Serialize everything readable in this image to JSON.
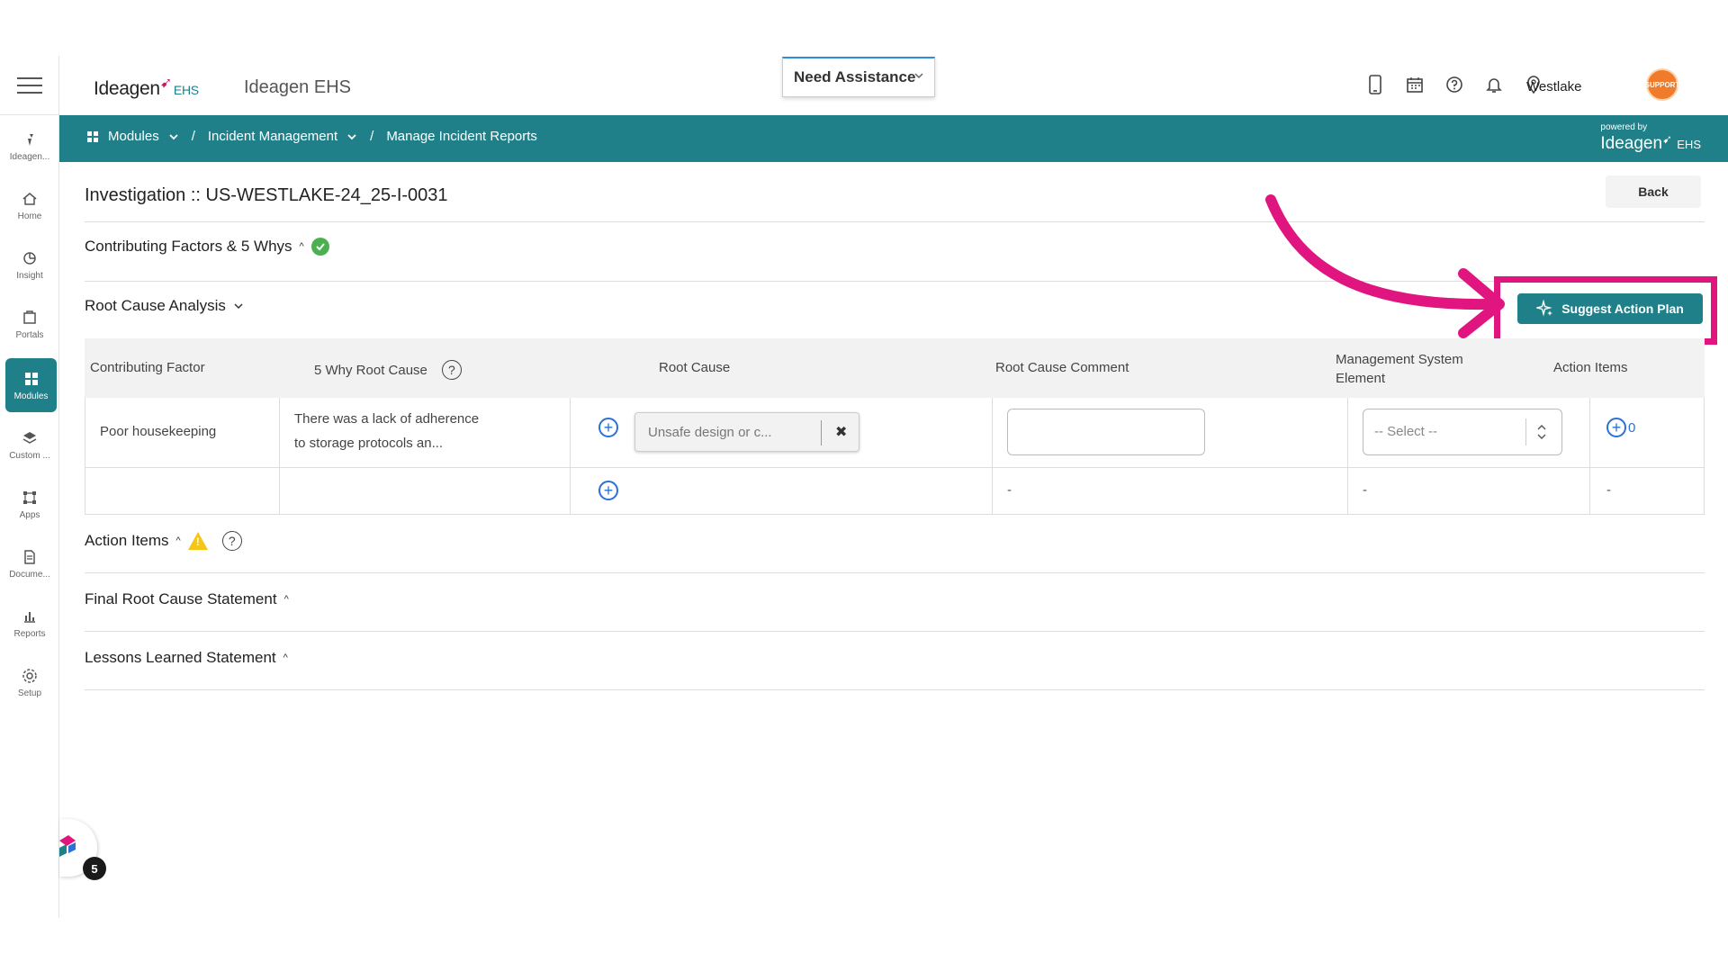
{
  "rail": {
    "items": [
      {
        "label": "Ideagen...",
        "icon": "ideagen-icon"
      },
      {
        "label": "Home",
        "icon": "home-icon"
      },
      {
        "label": "Insight",
        "icon": "insight-icon"
      },
      {
        "label": "Portals",
        "icon": "portals-icon"
      },
      {
        "label": "Modules",
        "icon": "modules-icon"
      },
      {
        "label": "Custom ...",
        "icon": "custom-icon"
      },
      {
        "label": "Apps",
        "icon": "apps-icon"
      },
      {
        "label": "Docume...",
        "icon": "documents-icon"
      },
      {
        "label": "Reports",
        "icon": "reports-icon"
      },
      {
        "label": "Setup",
        "icon": "setup-icon"
      }
    ]
  },
  "header": {
    "logo_text": "Ideagen",
    "logo_suffix": "EHS",
    "app_name": "Ideagen EHS",
    "assistance": "Need Assistance",
    "location": "Westlake",
    "avatar_text": "SUPPORT"
  },
  "breadcrumb": {
    "modules": "Modules",
    "incident_management": "Incident Management",
    "manage_reports": "Manage Incident Reports",
    "sep": "/",
    "powered_by": "powered by",
    "powered_logo": "Ideagen",
    "powered_suffix": "EHS"
  },
  "page": {
    "title": "Investigation :: US-WESTLAKE-24_25-I-0031",
    "back_label": "Back"
  },
  "sections": {
    "contributing": "Contributing Factors & 5 Whys",
    "rca": "Root Cause Analysis",
    "action_items": "Action Items",
    "final_statement": "Final Root Cause Statement",
    "lessons": "Lessons Learned Statement"
  },
  "suggest_label": "Suggest Action Plan",
  "table": {
    "headers": {
      "contributing_factor": "Contributing Factor",
      "five_why": "5 Why Root Cause",
      "root_cause": "Root Cause",
      "comment": "Root Cause Comment",
      "mse_line1": "Management System",
      "mse_line2": "Element",
      "action_items": "Action Items"
    },
    "row1": {
      "factor": "Poor housekeeping",
      "five_why_line1": "There was a lack of adherence",
      "five_why_line2": "to storage protocols an...",
      "root_cause_value": "Unsafe design or c...",
      "select_value": "-- Select --",
      "action_count": "0"
    },
    "row2": {
      "comment": "-",
      "mse": "-",
      "actions": "-"
    }
  },
  "widget": {
    "badge": "5"
  },
  "colors": {
    "teal": "#1f8089",
    "highlight": "#e0157f",
    "success": "#4caf50",
    "warning": "#f5c518"
  }
}
